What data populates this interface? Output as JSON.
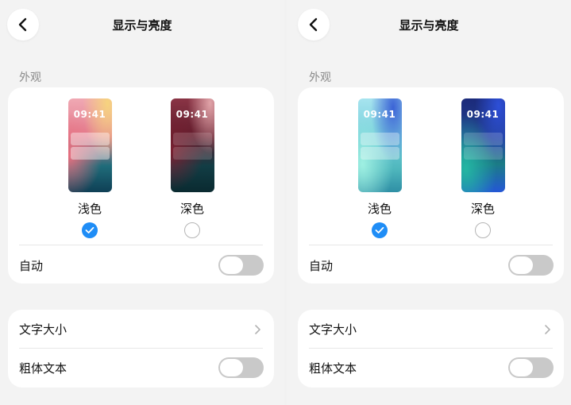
{
  "screens": [
    {
      "title": "显示与亮度",
      "section_label": "外观",
      "themes": [
        {
          "label": "浅色",
          "time": "09:41",
          "selected": true
        },
        {
          "label": "深色",
          "time": "09:41",
          "selected": false
        }
      ],
      "auto_label": "自动",
      "auto_enabled": false,
      "font_size_label": "文字大小",
      "bold_text_label": "粗体文本",
      "bold_text_enabled": false
    },
    {
      "title": "显示与亮度",
      "section_label": "外观",
      "themes": [
        {
          "label": "浅色",
          "time": "09:41",
          "selected": true
        },
        {
          "label": "深色",
          "time": "09:41",
          "selected": false
        }
      ],
      "auto_label": "自动",
      "auto_enabled": false,
      "font_size_label": "文字大小",
      "bold_text_label": "粗体文本",
      "bold_text_enabled": false
    }
  ],
  "colors": {
    "accent": "#1f8df6",
    "toggle_off": "#c9c9c9",
    "background": "#f3f3f3",
    "card": "#ffffff"
  },
  "icons": {
    "back": "chevron-left-icon",
    "row_disclosure": "chevron-right-icon",
    "selected": "checkmark-icon"
  }
}
